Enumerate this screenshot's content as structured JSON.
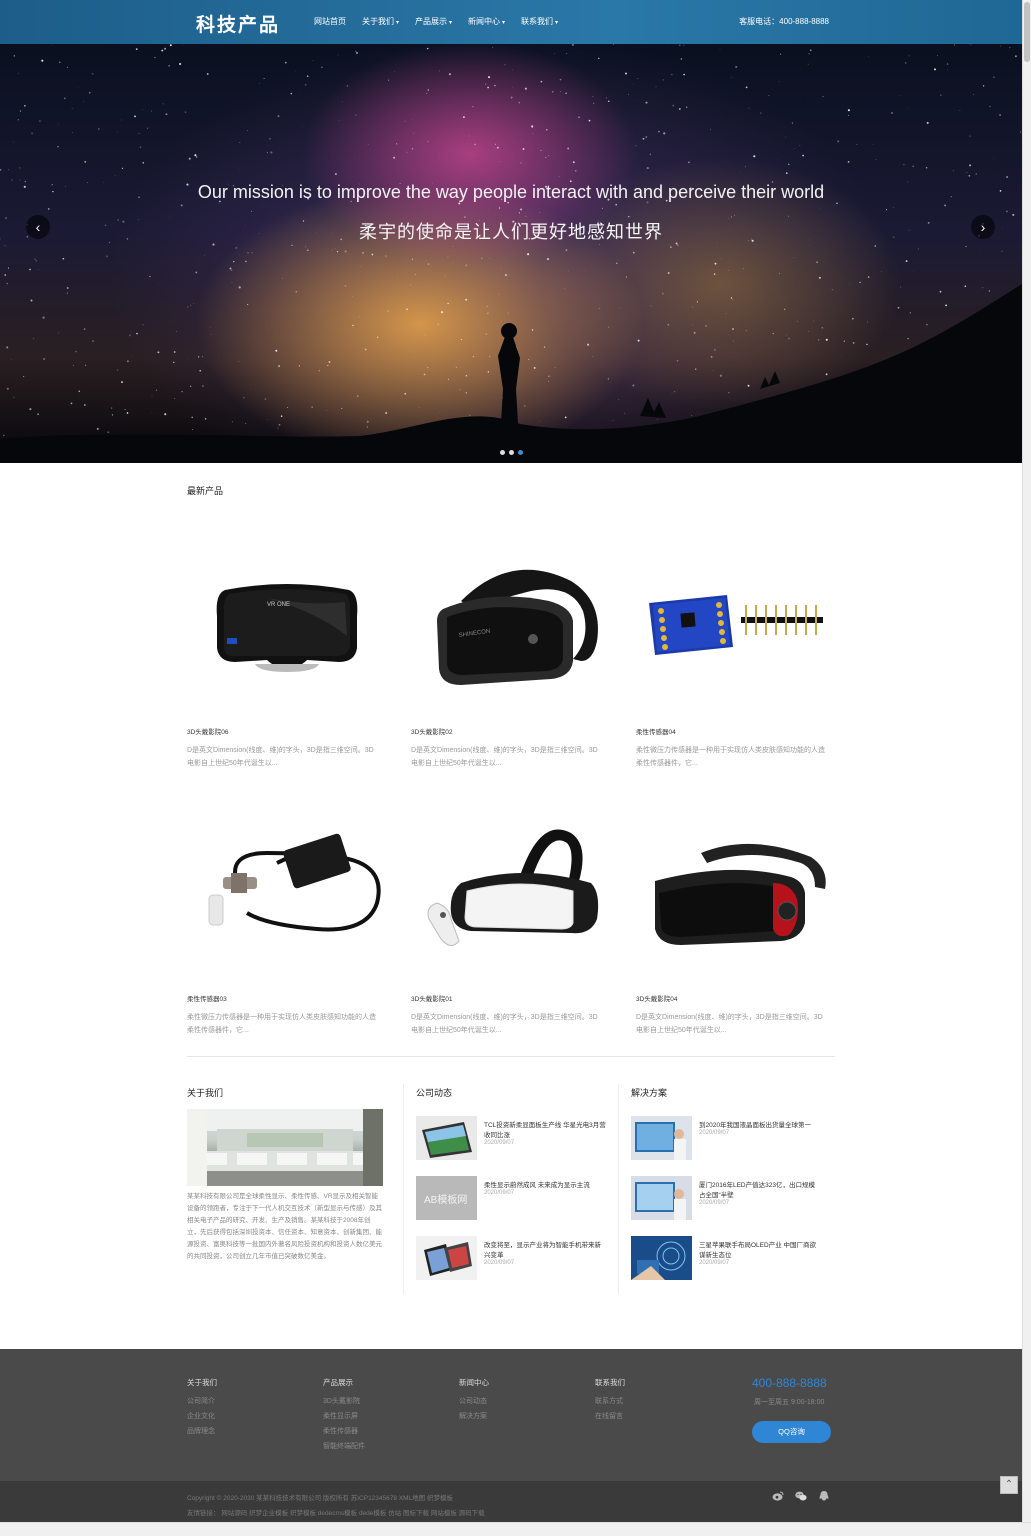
{
  "header": {
    "logo": "科技产品",
    "nav": [
      {
        "label": "网站首页",
        "caret": ""
      },
      {
        "label": "关于我们",
        "caret": "▾"
      },
      {
        "label": "产品展示",
        "caret": "▾"
      },
      {
        "label": "新闻中心",
        "caret": "▾"
      },
      {
        "label": "联系我们",
        "caret": "▾"
      }
    ],
    "hotline": "客服电话：400-888-8888"
  },
  "banner": {
    "title_en": "Our mission is to improve the way people interact with and perceive their world",
    "title_cn": "柔宇的使命是让人们更好地感知世界",
    "prev_icon": "‹",
    "next_icon": "›",
    "slides": 3,
    "active_slide": 3
  },
  "products": {
    "title": "最新产品",
    "items": [
      {
        "name": "3D头戴影院06",
        "desc": "D是英文Dimension(线度、维)的字头，3D是指三维空间。3D电影自上世纪50年代诞生以...",
        "icon": "vr-headset-zeiss"
      },
      {
        "name": "3D头戴影院02",
        "desc": "D是英文Dimension(线度、维)的字头，3D是指三维空间。3D电影自上世纪50年代诞生以...",
        "icon": "vr-headset-black"
      },
      {
        "name": "柔性传感器04",
        "desc": "柔性微压力传感器是一种用于实现仿人类皮肤感知功能的人造柔性传感器件，它...",
        "icon": "sensor-board"
      },
      {
        "name": "柔性传感器03",
        "desc": "柔性微压力传感器是一种用于实现仿人类皮肤感知功能的人造柔性传感器件，它...",
        "icon": "oxygen-sensor"
      },
      {
        "name": "3D头戴影院01",
        "desc": "D是英文Dimension(线度、维)的字头，3D是指三维空间。3D电影自上世纪50年代诞生以...",
        "icon": "vr-headset-white"
      },
      {
        "name": "3D头戴影院04",
        "desc": "D是英文Dimension(线度、维)的字头，3D是指三维空间。3D电影自上世纪50年代诞生以...",
        "icon": "vr-headset-red"
      }
    ]
  },
  "about": {
    "title": "关于我们",
    "text": "某某科技有限公司是全球柔性显示、柔性传感、VR显示及相关智能设备的领跑者，专注于下一代人机交互技术（新型显示与传感）及其相关电子产品的研究、开发、生产及销售。某某科技于2008年创立，先后获得包括深圳投资本、信任资本、知意资本、创新集团、能源投资、富奥科技等一批国内外著名风险投资机构和投资人数亿美元的共同投资，公司创立几年市值已突破数亿美金。"
  },
  "news": {
    "title": "公司动态",
    "items": [
      {
        "title": "TCL投资新柔显面板生产线 华星光电3月营收同比涨",
        "date": "2020/09/07"
      },
      {
        "title": "柔性显示蔚然成风 未来成为显示主流",
        "date": "2020/09/07"
      },
      {
        "title": "改变将至，显示产业将为智能手机带来新兴变革",
        "date": "2020/09/07"
      }
    ]
  },
  "solutions": {
    "title": "解决方案",
    "items": [
      {
        "title": "到2020年我国液晶面板出货量全球第一",
        "date": "2020/09/07"
      },
      {
        "title": "厦门2016年LED产值达323亿，出口规模占全国“半壁",
        "date": "2020/09/07"
      },
      {
        "title": "三星苹果联手布局OLED产业 中国厂商欲谋新生态位",
        "date": "2020/09/07"
      }
    ]
  },
  "news_thumb_text": "AB模板网",
  "footer": {
    "columns": [
      {
        "head": "关于我们",
        "links": [
          "公司简介",
          "企业文化",
          "品牌理念"
        ]
      },
      {
        "head": "产品展示",
        "links": [
          "3D头戴影院",
          "柔性显示屏",
          "柔性传感器",
          "智能终端配件"
        ]
      },
      {
        "head": "新闻中心",
        "links": [
          "公司动态",
          "解决方案"
        ]
      },
      {
        "head": "联系我们",
        "links": [
          "联系方式",
          "在线留言"
        ]
      }
    ],
    "phone": "400-888-8888",
    "hours": "周一至周五 9:00-18:00",
    "qq_button": "QQ咨询",
    "copyright_parts": [
      "Copyright © 2020-2030 某某科技技术有限公司 版权所有 ",
      "苏ICP12345678",
      " ",
      "XML地图",
      " ",
      "织梦模板"
    ],
    "friend_links_label": "友情链接：",
    "friend_links": [
      "网站源码",
      "织梦企业模板",
      "织梦模板",
      "dedecms模板",
      "dede模板",
      "仿站",
      "图标下载",
      "网站模板",
      "源码下载"
    ],
    "social_icons": [
      "weibo-icon",
      "wechat-icon",
      "qq-icon"
    ],
    "totop_icon": "⌃"
  }
}
